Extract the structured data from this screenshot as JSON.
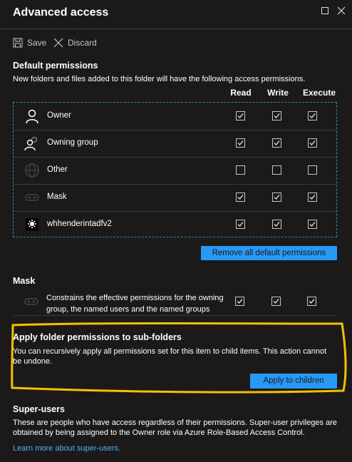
{
  "window": {
    "title": "Advanced access"
  },
  "toolbar": {
    "save_label": "Save",
    "discard_label": "Discard"
  },
  "default_permissions": {
    "heading": "Default permissions",
    "description": "New folders and files added to this folder will have the following access permissions.",
    "columns": [
      "Read",
      "Write",
      "Execute"
    ],
    "rows": [
      {
        "label": "Owner",
        "icon": "user-icon",
        "read": true,
        "write": true,
        "execute": true
      },
      {
        "label": "Owning group",
        "icon": "group-icon",
        "read": true,
        "write": true,
        "execute": true
      },
      {
        "label": "Other",
        "icon": "globe-icon",
        "read": false,
        "write": false,
        "execute": false
      },
      {
        "label": "Mask",
        "icon": "mask-icon",
        "read": true,
        "write": true,
        "execute": true
      },
      {
        "label": "whhenderintadfv2",
        "icon": "app-icon",
        "read": true,
        "write": true,
        "execute": true
      }
    ],
    "remove_button": "Remove all default permissions"
  },
  "mask": {
    "heading": "Mask",
    "description": "Constrains the effective permissions for the owning group, the named users and the named groups",
    "read": true,
    "write": true,
    "execute": true
  },
  "apply_section": {
    "heading": "Apply folder permissions to sub-folders",
    "description": "You can recursively apply all permissions set for this item to child items. This action cannot be undone.",
    "button": "Apply to children"
  },
  "super_users": {
    "heading": "Super-users",
    "description": "These are people who have access regardless of their permissions. Super-user privileges are obtained by being assigned to the Owner role via Azure Role-Based Access Control.",
    "link": "Learn more about super-users."
  },
  "colors": {
    "accent": "#2899f5",
    "link": "#4fb0ff",
    "highlight": "#f2c200",
    "background": "#1b1a19"
  }
}
